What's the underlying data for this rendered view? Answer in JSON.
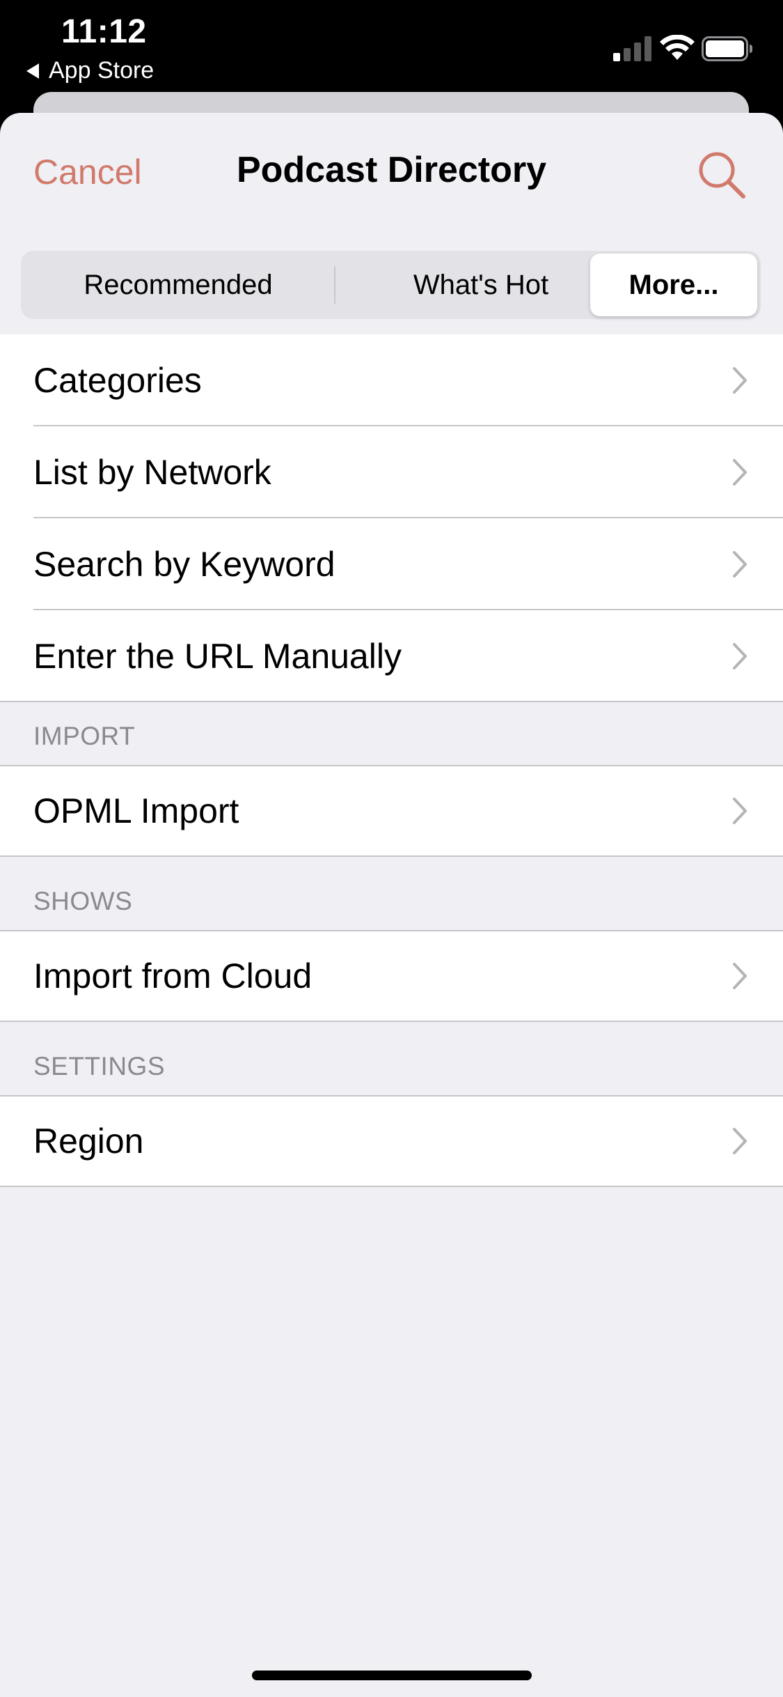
{
  "status_bar": {
    "time": "11:12",
    "back_label": "App Store",
    "icons": [
      "signal-icon",
      "wifi-icon",
      "battery-icon"
    ]
  },
  "nav": {
    "cancel_label": "Cancel",
    "title": "Podcast Directory",
    "search_icon": "search-icon"
  },
  "segments": {
    "items": [
      {
        "label": "Recommended"
      },
      {
        "label": "What's Hot"
      },
      {
        "label": "More..."
      }
    ],
    "selected": "More..."
  },
  "list": {
    "main": [
      {
        "label": "Categories"
      },
      {
        "label": "List by Network"
      },
      {
        "label": "Search by Keyword"
      },
      {
        "label": "Enter the URL Manually"
      }
    ],
    "sections": [
      {
        "header": "IMPORT",
        "items": [
          {
            "label": "OPML Import"
          }
        ]
      },
      {
        "header": "SHOWS",
        "items": [
          {
            "label": "Import from Cloud"
          }
        ]
      },
      {
        "header": "SETTINGS",
        "items": [
          {
            "label": "Region"
          }
        ]
      }
    ]
  },
  "colors": {
    "accent": "#d17a6c",
    "background": "#efeff4",
    "separator": "#c6c6c8",
    "section_header": "#8a8a8e"
  }
}
